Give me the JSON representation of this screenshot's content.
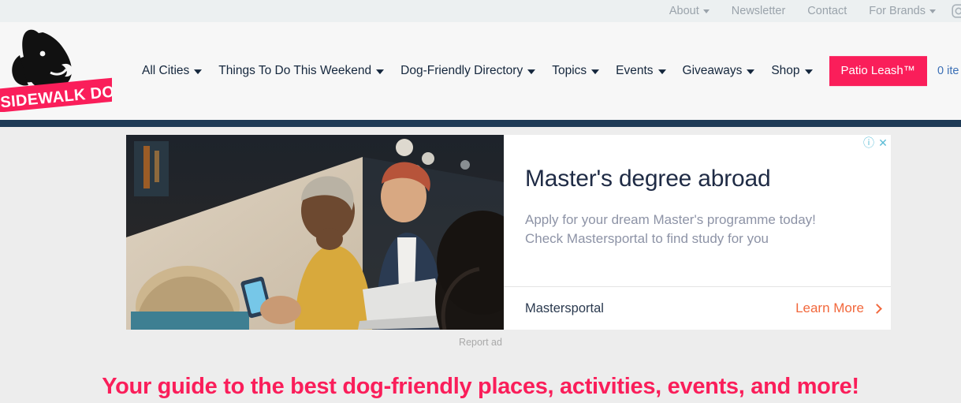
{
  "topbar": {
    "links": [
      {
        "label": "About",
        "caret": true
      },
      {
        "label": "Newsletter",
        "caret": false
      },
      {
        "label": "Contact",
        "caret": false
      },
      {
        "label": "For Brands",
        "caret": true
      }
    ],
    "social_icon": "instagram-icon"
  },
  "header": {
    "logo_text": "SIDEWALK DOG",
    "logo_icon": "dog-head-icon",
    "nav": [
      {
        "label": "All Cities",
        "caret": true
      },
      {
        "label": "Things To Do This Weekend",
        "caret": true
      },
      {
        "label": "Dog-Friendly Directory",
        "caret": true
      },
      {
        "label": "Topics",
        "caret": true
      },
      {
        "label": "Events",
        "caret": true
      },
      {
        "label": "Giveaways",
        "caret": true
      },
      {
        "label": "Shop",
        "caret": true
      }
    ],
    "cta_label": "Patio Leash™",
    "cart_label": "0 ite"
  },
  "ad": {
    "title": "Master's degree abroad",
    "description_line1": "Apply for your dream Master's programme today!",
    "description_line2": "Check Mastersportal to find study for you",
    "advertiser": "Mastersportal",
    "cta_label": "Learn More",
    "info_icon": "ⓘ",
    "close_icon": "✕",
    "report_label": "Report ad",
    "image_alt": "students-collaborating-photo"
  },
  "tagline": "Your guide to the best dog-friendly places, activities, events, and more!",
  "colors": {
    "brand_pink": "#fa1e5a",
    "navy": "#1e3a56",
    "ad_orange": "#f2683c",
    "cart_blue": "#3b6fb5",
    "topbar_bg": "#ecf0f1",
    "header_bg": "#f7f7f7",
    "page_bg": "#ededed"
  }
}
